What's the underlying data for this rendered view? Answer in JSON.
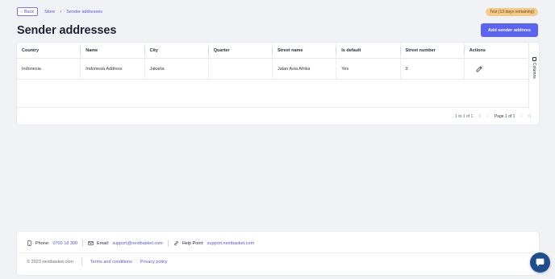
{
  "topbar": {
    "back_label": "Back",
    "breadcrumbs": [
      "Store",
      "Sender addresses"
    ],
    "trial_badge": "Test (13 days remaining)"
  },
  "page": {
    "title": "Sender addresses",
    "add_button": "Add sender address"
  },
  "table": {
    "columns": [
      "Country",
      "Name",
      "City",
      "Quarter",
      "Street name",
      "Is default",
      "Street number",
      "Actions"
    ],
    "rows": [
      {
        "country": "Indonesia",
        "name": "Indonesia Address",
        "city": "Jakarta",
        "quarter": "",
        "street_name": "Jalan Asia Afrika",
        "is_default": "Yes",
        "street_number": "9",
        "action_icon": "pencil-icon"
      }
    ],
    "side_panel_label": "Columns",
    "pagination": {
      "summary": "1 to 1 of 1",
      "page_label": "Page 1 of 1"
    }
  },
  "footer": {
    "phone_label": "Phone:",
    "phone_value": "0700 18 300",
    "email_label": "Email:",
    "email_value": "support@nextbasket.com",
    "help_label": "Help Point:",
    "help_value": "support.nextbasket.com",
    "copyright": "© 2023 nextbasket.com",
    "terms": "Terms and conditions",
    "privacy": "Privacy policy"
  },
  "colors": {
    "accent": "#5b64f0",
    "link": "#5a52d6",
    "badge": "#f5c98a",
    "chat": "#1f4e8f"
  }
}
